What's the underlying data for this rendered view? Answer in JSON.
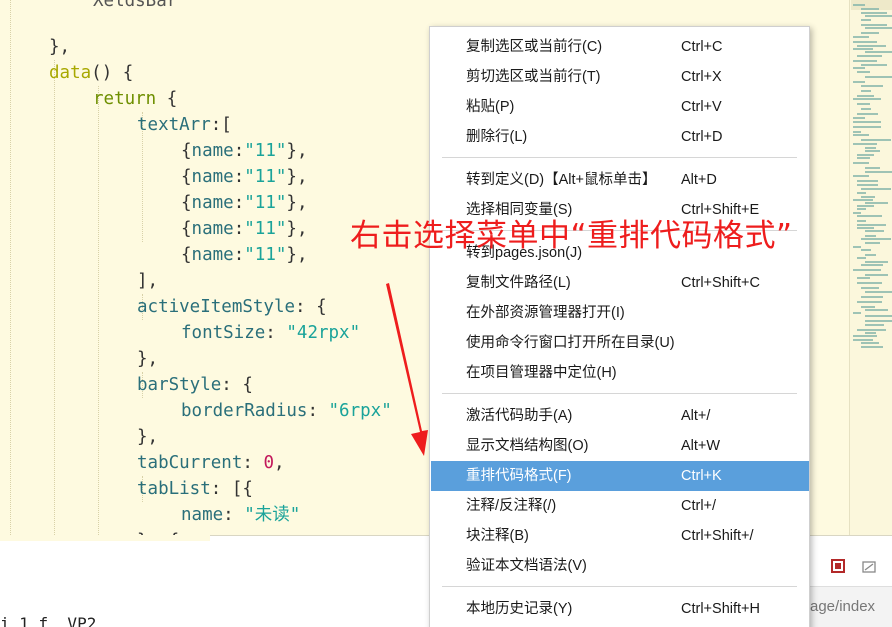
{
  "editor": {
    "lines": [
      {
        "indent": 1,
        "parts": [
          {
            "t": "},",
            "c": "punc"
          }
        ]
      },
      {
        "indent": 1,
        "parts": [
          {
            "t": "data",
            "c": "kw"
          },
          {
            "t": "() {",
            "c": "punc"
          }
        ]
      },
      {
        "indent": 2,
        "parts": [
          {
            "t": "return",
            "c": "kw2"
          },
          {
            "t": " {",
            "c": "punc"
          }
        ]
      },
      {
        "indent": 3,
        "parts": [
          {
            "t": "textArr",
            "c": "prop"
          },
          {
            "t": ":[",
            "c": "punc"
          }
        ]
      },
      {
        "indent": 4,
        "parts": [
          {
            "t": "{",
            "c": "punc"
          },
          {
            "t": "name",
            "c": "prop"
          },
          {
            "t": ":",
            "c": "punc"
          },
          {
            "t": "\"11\"",
            "c": "str"
          },
          {
            "t": "},",
            "c": "punc"
          }
        ]
      },
      {
        "indent": 4,
        "parts": [
          {
            "t": "{",
            "c": "punc"
          },
          {
            "t": "name",
            "c": "prop"
          },
          {
            "t": ":",
            "c": "punc"
          },
          {
            "t": "\"11\"",
            "c": "str"
          },
          {
            "t": "},",
            "c": "punc"
          }
        ]
      },
      {
        "indent": 4,
        "parts": [
          {
            "t": "{",
            "c": "punc"
          },
          {
            "t": "name",
            "c": "prop"
          },
          {
            "t": ":",
            "c": "punc"
          },
          {
            "t": "\"11\"",
            "c": "str"
          },
          {
            "t": "},",
            "c": "punc"
          }
        ]
      },
      {
        "indent": 4,
        "parts": [
          {
            "t": "{",
            "c": "punc"
          },
          {
            "t": "name",
            "c": "prop"
          },
          {
            "t": ":",
            "c": "punc"
          },
          {
            "t": "\"11\"",
            "c": "str"
          },
          {
            "t": "},",
            "c": "punc"
          }
        ]
      },
      {
        "indent": 4,
        "parts": [
          {
            "t": "{",
            "c": "punc"
          },
          {
            "t": "name",
            "c": "prop"
          },
          {
            "t": ":",
            "c": "punc"
          },
          {
            "t": "\"11\"",
            "c": "str"
          },
          {
            "t": "},",
            "c": "punc"
          }
        ]
      },
      {
        "indent": 3,
        "parts": [
          {
            "t": "],",
            "c": "punc"
          }
        ]
      },
      {
        "indent": 3,
        "parts": [
          {
            "t": "activeItemStyle",
            "c": "prop"
          },
          {
            "t": ": {",
            "c": "punc"
          }
        ]
      },
      {
        "indent": 4,
        "parts": [
          {
            "t": "fontSize",
            "c": "prop"
          },
          {
            "t": ": ",
            "c": "punc"
          },
          {
            "t": "\"42rpx\"",
            "c": "str"
          }
        ]
      },
      {
        "indent": 3,
        "parts": [
          {
            "t": "},",
            "c": "punc"
          }
        ]
      },
      {
        "indent": 3,
        "parts": [
          {
            "t": "barStyle",
            "c": "prop"
          },
          {
            "t": ": {",
            "c": "punc"
          }
        ]
      },
      {
        "indent": 4,
        "parts": [
          {
            "t": "borderRadius",
            "c": "prop"
          },
          {
            "t": ": ",
            "c": "punc"
          },
          {
            "t": "\"6rpx\"",
            "c": "str"
          }
        ]
      },
      {
        "indent": 3,
        "parts": [
          {
            "t": "},",
            "c": "punc"
          }
        ]
      },
      {
        "indent": 3,
        "parts": [
          {
            "t": "tabCurrent",
            "c": "prop"
          },
          {
            "t": ": ",
            "c": "punc"
          },
          {
            "t": "0",
            "c": "num"
          },
          {
            "t": ",",
            "c": "punc"
          }
        ]
      },
      {
        "indent": 3,
        "parts": [
          {
            "t": "tabList",
            "c": "prop"
          },
          {
            "t": ": [{",
            "c": "punc"
          }
        ]
      },
      {
        "indent": 4,
        "parts": [
          {
            "t": "name",
            "c": "prop"
          },
          {
            "t": ": ",
            "c": "punc"
          },
          {
            "t": "\"未读\"",
            "c": "str"
          }
        ]
      },
      {
        "indent": 3,
        "parts": [
          {
            "t": "}, {",
            "c": "punc"
          }
        ]
      }
    ]
  },
  "context_menu": {
    "items": [
      {
        "label": "复制选区或当前行(C)",
        "shortcut": "Ctrl+C"
      },
      {
        "label": "剪切选区或当前行(T)",
        "shortcut": "Ctrl+X"
      },
      {
        "label": "粘贴(P)",
        "shortcut": "Ctrl+V"
      },
      {
        "label": "删除行(L)",
        "shortcut": "Ctrl+D"
      },
      {
        "label": "转到定义(D)【Alt+鼠标单击】",
        "shortcut": "Alt+D"
      },
      {
        "label": "选择相同变量(S)",
        "shortcut": "Ctrl+Shift+E"
      },
      {
        "label": "转到pages.json(J)",
        "shortcut": ""
      },
      {
        "label": "复制文件路径(L)",
        "shortcut": "Ctrl+Shift+C"
      },
      {
        "label": "在外部资源管理器打开(I)",
        "shortcut": ""
      },
      {
        "label": "使用命令行窗口打开所在目录(U)",
        "shortcut": ""
      },
      {
        "label": "在项目管理器中定位(H)",
        "shortcut": ""
      },
      {
        "label": "激活代码助手(A)",
        "shortcut": "Alt+/"
      },
      {
        "label": "显示文档结构图(O)",
        "shortcut": "Alt+W"
      },
      {
        "label": "重排代码格式(F)",
        "shortcut": "Ctrl+K",
        "selected": true
      },
      {
        "label": "注释/反注释(/)",
        "shortcut": "Ctrl+/"
      },
      {
        "label": "块注释(B)",
        "shortcut": "Ctrl+Shift+/"
      },
      {
        "label": "验证本文档语法(V)",
        "shortcut": ""
      },
      {
        "label": "本地历史记录(Y)",
        "shortcut": "Ctrl+Shift+H"
      }
    ]
  },
  "annotation": {
    "text": "右击选择菜单中“重排代码格式”",
    "color": "#ee1d1d"
  },
  "bottom_panel": {
    "path_text": "age/index",
    "console_text": "i 1 f  VP2"
  },
  "colors": {
    "editor_bg": "#fefae0",
    "selection": "#5a9fdc",
    "annotation": "#ee1d1d"
  }
}
